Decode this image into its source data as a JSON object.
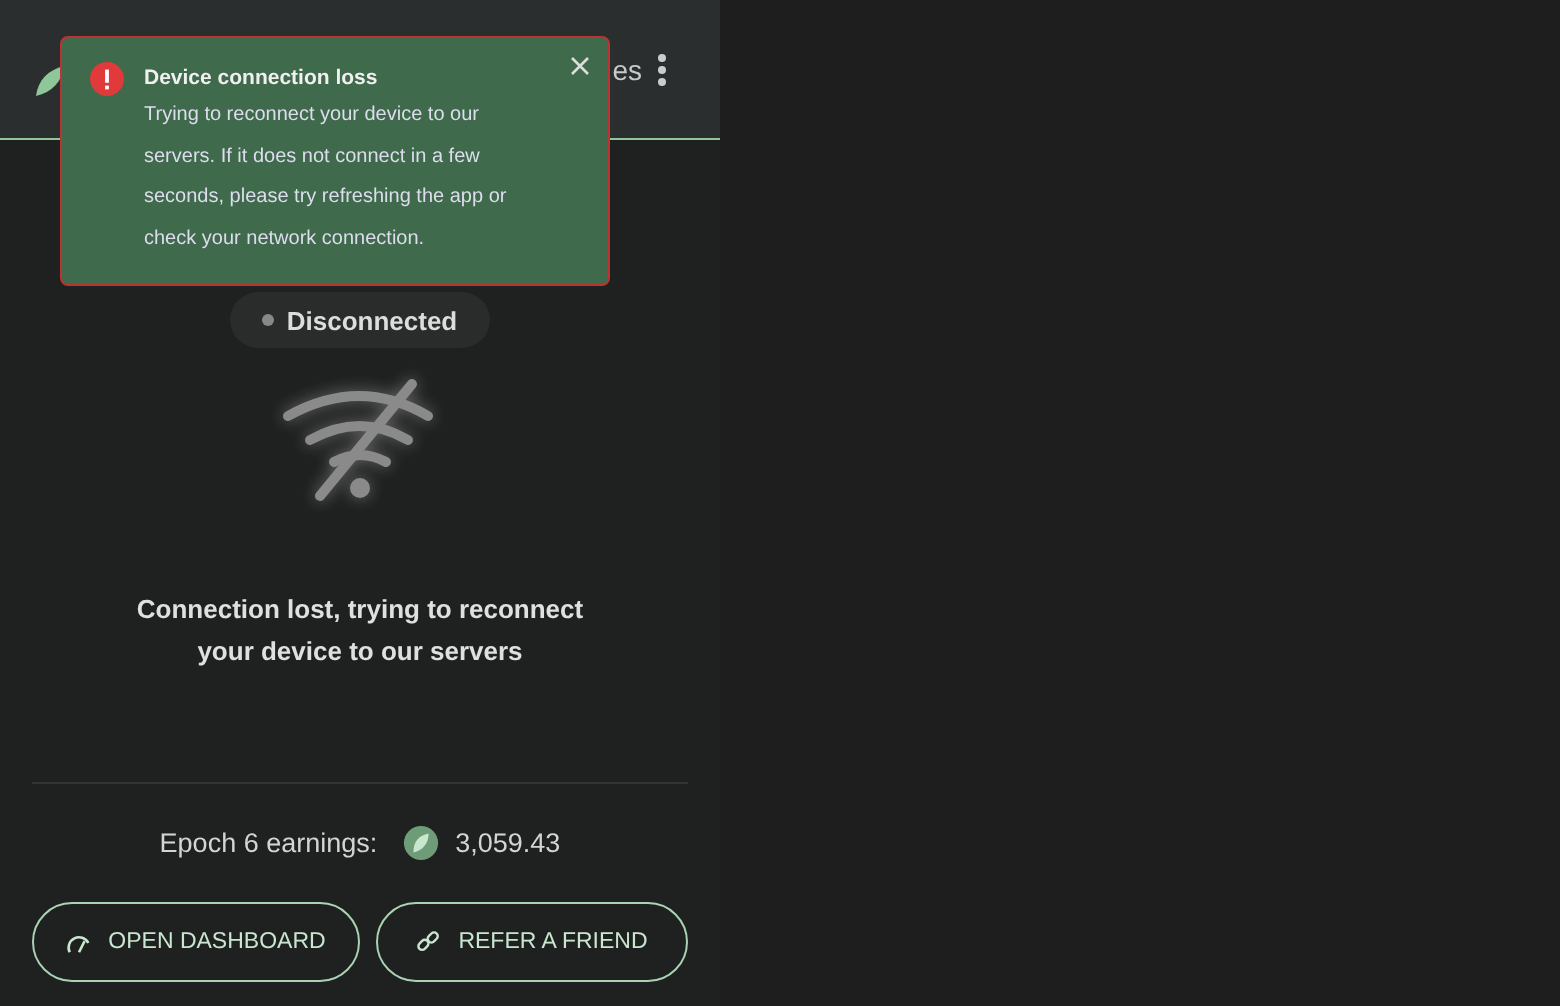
{
  "header": {
    "user_label": "es"
  },
  "toast": {
    "title": "Device connection loss",
    "message": "Trying to reconnect your device to our servers. If it does not connect in a few seconds, please try refreshing the app or check your network connection."
  },
  "status": {
    "label": "Disconnected"
  },
  "message": "Connection lost, trying to reconnect your device to our servers",
  "earnings": {
    "label": "Epoch 6 earnings:",
    "value": "3,059.43"
  },
  "buttons": [
    {
      "kind": "dashboard",
      "label": "OPEN DASHBOARD"
    },
    {
      "kind": "refer",
      "label": "REFER A FRIEND"
    }
  ]
}
